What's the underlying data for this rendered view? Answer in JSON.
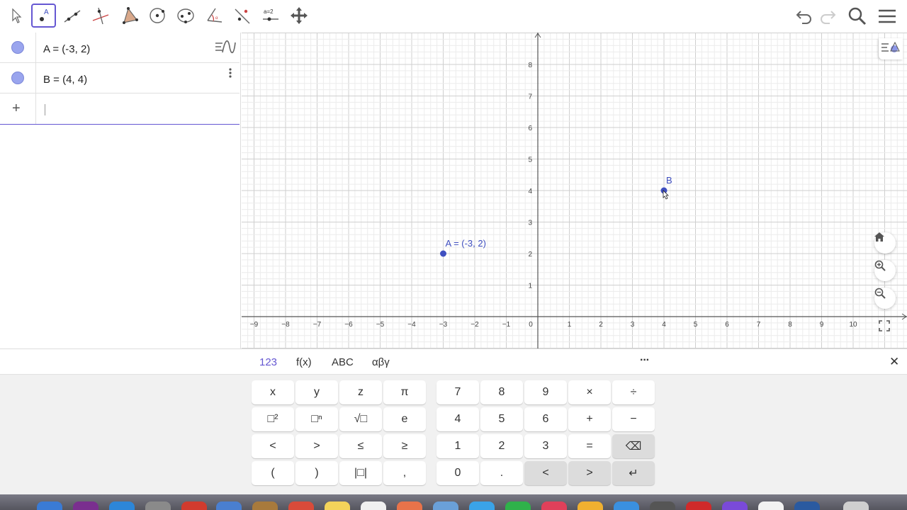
{
  "toolbar": {
    "tools": [
      {
        "name": "move-tool",
        "active": false
      },
      {
        "name": "point-tool",
        "active": true,
        "label": "A"
      },
      {
        "name": "line-tool",
        "active": false
      },
      {
        "name": "perpendicular-tool",
        "active": false
      },
      {
        "name": "polygon-tool",
        "active": false
      },
      {
        "name": "circle-tool",
        "active": false
      },
      {
        "name": "ellipse-tool",
        "active": false
      },
      {
        "name": "angle-tool",
        "active": false
      },
      {
        "name": "reflect-tool",
        "active": false
      },
      {
        "name": "slider-tool",
        "active": false,
        "label": "a = 2"
      },
      {
        "name": "move-graphics-tool",
        "active": false
      }
    ],
    "right_icons": [
      "undo-icon",
      "redo-icon",
      "search-icon",
      "menu-icon"
    ]
  },
  "algebra": {
    "items": [
      {
        "label": "A = (-3, 2)",
        "color": "#9aa5ee"
      },
      {
        "label": "B = (4, 4)",
        "color": "#9aa5ee"
      }
    ],
    "input_placeholder": "",
    "plus_label": "+"
  },
  "graphics": {
    "x_ticks": [
      "−9",
      "−8",
      "−7",
      "−6",
      "−5",
      "−4",
      "−3",
      "−2",
      "−1",
      "0",
      "1",
      "2",
      "3",
      "4",
      "5",
      "6",
      "7",
      "8",
      "9",
      "10"
    ],
    "y_ticks": [
      "1",
      "2",
      "3",
      "4",
      "5",
      "6",
      "7",
      "8"
    ],
    "points": [
      {
        "name": "A",
        "x": -3,
        "y": 2,
        "label": "A = (-3, 2)"
      },
      {
        "name": "B",
        "x": 4,
        "y": 4,
        "label": "B"
      }
    ],
    "point_color": "#3f4fc0",
    "buttons": [
      "home-icon",
      "zoom-in-icon",
      "zoom-out-icon",
      "fullscreen-icon"
    ]
  },
  "keyboard": {
    "tabs": [
      "123",
      "f(x)",
      "ABC",
      "αβγ"
    ],
    "active_tab": "123",
    "more_label": "···",
    "close_label": "✕",
    "left_keys": [
      [
        "x",
        "y",
        "z",
        "π"
      ],
      [
        "□²",
        "□ⁿ",
        "√□",
        "e"
      ],
      [
        "<",
        ">",
        "≤",
        "≥"
      ],
      [
        "(",
        ")",
        "|□|",
        ","
      ]
    ],
    "right_keys": [
      [
        "7",
        "8",
        "9",
        "×",
        "÷"
      ],
      [
        "4",
        "5",
        "6",
        "+",
        "−"
      ],
      [
        "1",
        "2",
        "3",
        "=",
        "⌫"
      ],
      [
        "0",
        ".",
        "<",
        ">",
        "↵"
      ]
    ]
  }
}
